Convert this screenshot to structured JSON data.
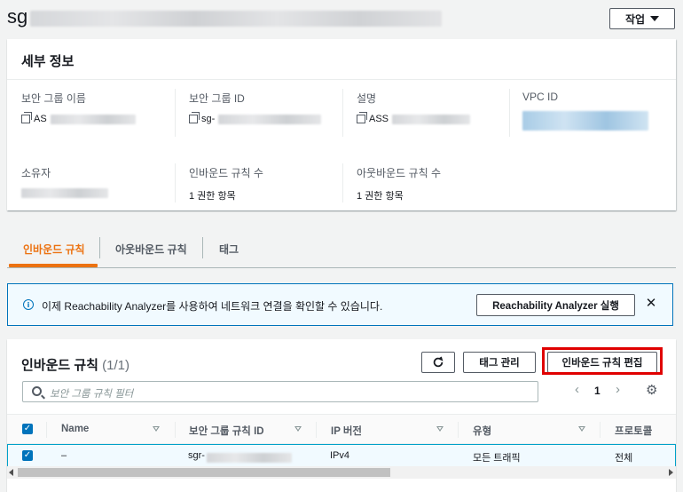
{
  "header": {
    "title_prefix": "sg",
    "action_label": "작업"
  },
  "details": {
    "title": "세부 정보",
    "fields": [
      {
        "label": "보안 그룹 이름",
        "value": "AS"
      },
      {
        "label": "보안 그룹 ID",
        "value": "sg-"
      },
      {
        "label": "설명",
        "value": "ASS"
      },
      {
        "label": "VPC ID",
        "value": ""
      },
      {
        "label": "소유자",
        "value": ""
      },
      {
        "label": "인바운드 규칙 수",
        "value": "1 권한 항목"
      },
      {
        "label": "아웃바운드 규칙 수",
        "value": "1 권한 항목"
      }
    ]
  },
  "tabs": [
    {
      "label": "인바운드 규칙",
      "active": true
    },
    {
      "label": "아웃바운드 규칙",
      "active": false
    },
    {
      "label": "태그",
      "active": false
    }
  ],
  "banner": {
    "text": "이제 Reachability Analyzer를 사용하여 네트워크 연결을 확인할 수 있습니다.",
    "button": "Reachability Analyzer 실행"
  },
  "rules": {
    "title": "인바운드 규칙",
    "count": "(1/1)",
    "manage_tags": "태그 관리",
    "edit_rules": "인바운드 규칙 편집",
    "filter_placeholder": "보안 그룹 규칙 필터",
    "page": "1",
    "columns": [
      "Name",
      "보안 그룹 규칙 ID",
      "IP 버전",
      "유형",
      "프로토콜"
    ],
    "rows": [
      {
        "name": "–",
        "rule_id": "sgr-",
        "ip_version": "IPv4",
        "type": "모든 트래픽",
        "protocol": "전체"
      }
    ]
  },
  "colors": {
    "accent": "#ec7211",
    "link": "#0073bb",
    "highlight": "#e00000"
  }
}
